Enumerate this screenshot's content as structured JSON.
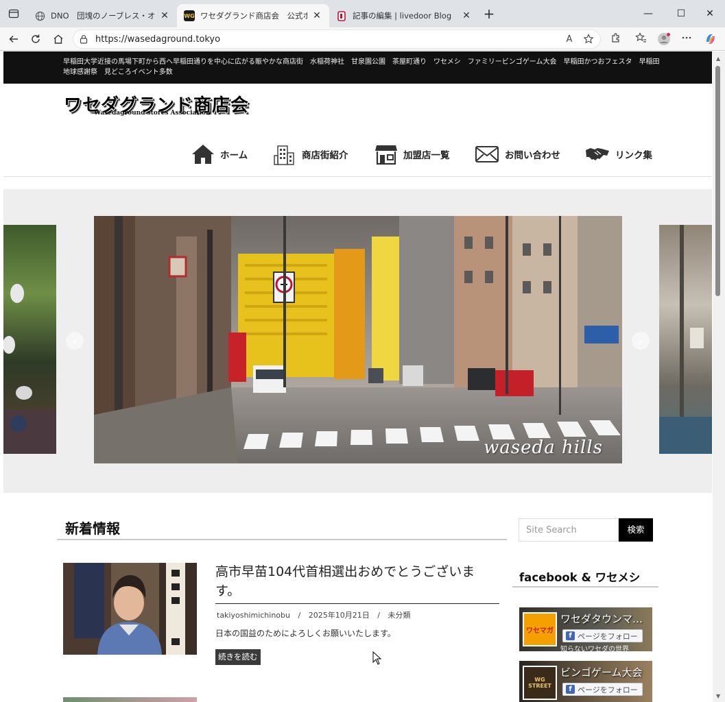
{
  "browser": {
    "tabs": [
      {
        "title": "DNO　団塊のノーブレス・オブリージュ",
        "close": "✕"
      },
      {
        "title": "ワセダグランド商店会　公式ホームページ",
        "favicon_text": "WG",
        "close": "✕"
      },
      {
        "title": "記事の編集 | livedoor Blog",
        "close": "✕"
      }
    ],
    "new_tab": "+",
    "url": "https://wasedaground.tokyo",
    "read_aloud": "A",
    "window_controls": {
      "minimize": "—",
      "maximize": "☐",
      "close": "✕"
    }
  },
  "site": {
    "top_strip": "早稲田大学近接の馬場下町から西へ早稲田通りを中心に広がる賑やかな商店街　水稲荷神社　甘泉園公園　茶屋町通り　ワセメシ　ファミリービンゴゲーム大会　早稲田かつおフェスタ　早稲田地球感謝祭　見どころイベント多数",
    "logo": {
      "title": "ワセダグランド商店会",
      "subtitle": "Wasedaground stores Association"
    },
    "nav": [
      {
        "label": "ホーム",
        "icon": "home-icon"
      },
      {
        "label": "商店街紹介",
        "icon": "building-icon"
      },
      {
        "label": "加盟店一覧",
        "icon": "shop-icon"
      },
      {
        "label": "お問い合わせ",
        "icon": "envelope-icon"
      },
      {
        "label": "リンク集",
        "icon": "handshake-icon"
      }
    ],
    "slider": {
      "caption": "waseda hills",
      "prev": "‹",
      "next": "›"
    },
    "news": {
      "heading": "新着情報",
      "post": {
        "title": "高市早苗104代首相選出おめでとうございます。",
        "author": "takiyoshimichinobu",
        "date": "2025年10月21日",
        "category": "未分類",
        "separator": "/",
        "excerpt": "日本の国益のためによろしくお願いいたします。",
        "read_more": "続きを読む"
      }
    },
    "sidebar": {
      "search_placeholder": "Site Search",
      "search_button": "検索",
      "facebook_heading": "facebook & ワセメシ",
      "fb_cards": [
        {
          "name": "ワセダタウンマガジン",
          "avatar_text": "ワセマガ",
          "follow": "ページをフォロー",
          "tag": "知らないワセダの世界"
        },
        {
          "name": "ビンゴゲーム大会",
          "avatar_text": "WG STREET",
          "follow": "ページをフォロー"
        }
      ]
    }
  }
}
